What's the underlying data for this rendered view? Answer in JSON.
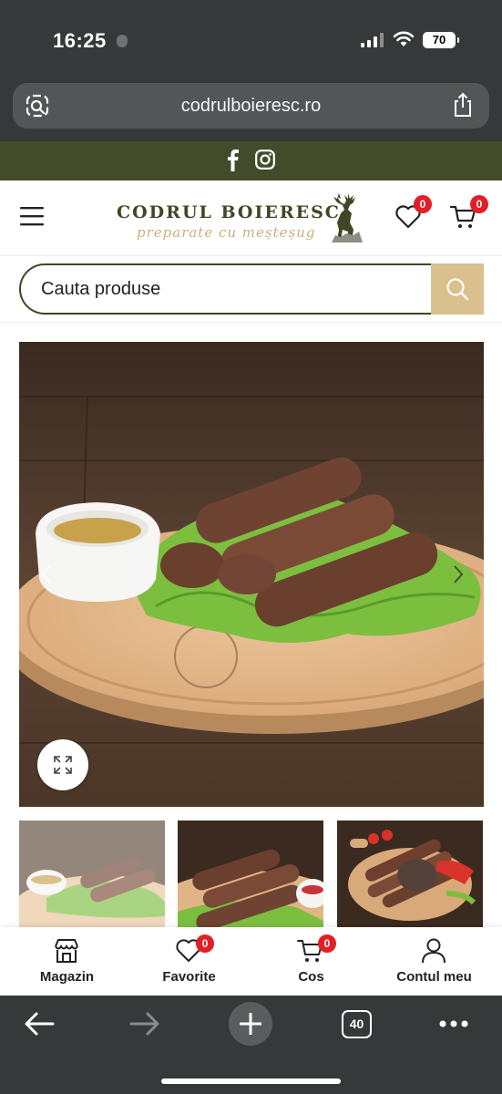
{
  "status": {
    "time": "16:25",
    "battery": "70"
  },
  "browser": {
    "url": "codrulboieresc.ro",
    "tab_count": "40"
  },
  "site": {
    "logo_title": "CODRUL BOIERESC",
    "logo_subtitle": "preparate cu meșteșug",
    "wishlist_count": "0",
    "cart_count": "0"
  },
  "search": {
    "placeholder": "Cauta produse"
  },
  "bottom_nav": {
    "items": [
      {
        "label": "Magazin",
        "icon": "store-icon"
      },
      {
        "label": "Favorite",
        "icon": "heart-icon",
        "badge": "0"
      },
      {
        "label": "Cos",
        "icon": "cart-icon",
        "badge": "0"
      },
      {
        "label": "Contul meu",
        "icon": "user-icon"
      }
    ]
  },
  "colors": {
    "brand_dark": "#434c2a",
    "accent_gold": "#d9c08d",
    "badge_red": "#e21f26"
  }
}
